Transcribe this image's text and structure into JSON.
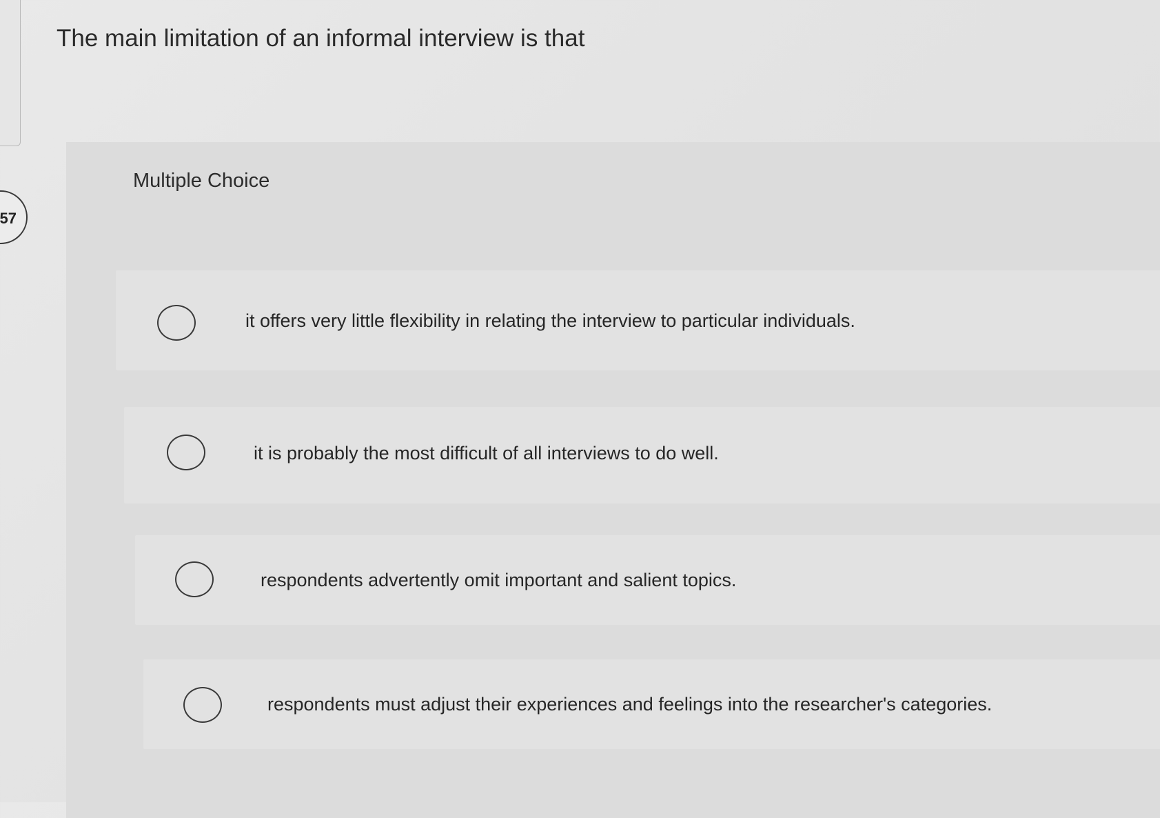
{
  "question": {
    "number": "57",
    "text": "The main limitation of an informal interview is that"
  },
  "question_type": "Multiple Choice",
  "options": [
    {
      "label": "it offers very little flexibility in relating the interview to particular individuals.",
      "selected": false
    },
    {
      "label": "it is probably the most difficult of all interviews to do well.",
      "selected": false
    },
    {
      "label": "respondents advertently omit important and salient topics.",
      "selected": false
    },
    {
      "label": "respondents must adjust their experiences and feelings into the researcher's categories.",
      "selected": false
    }
  ]
}
